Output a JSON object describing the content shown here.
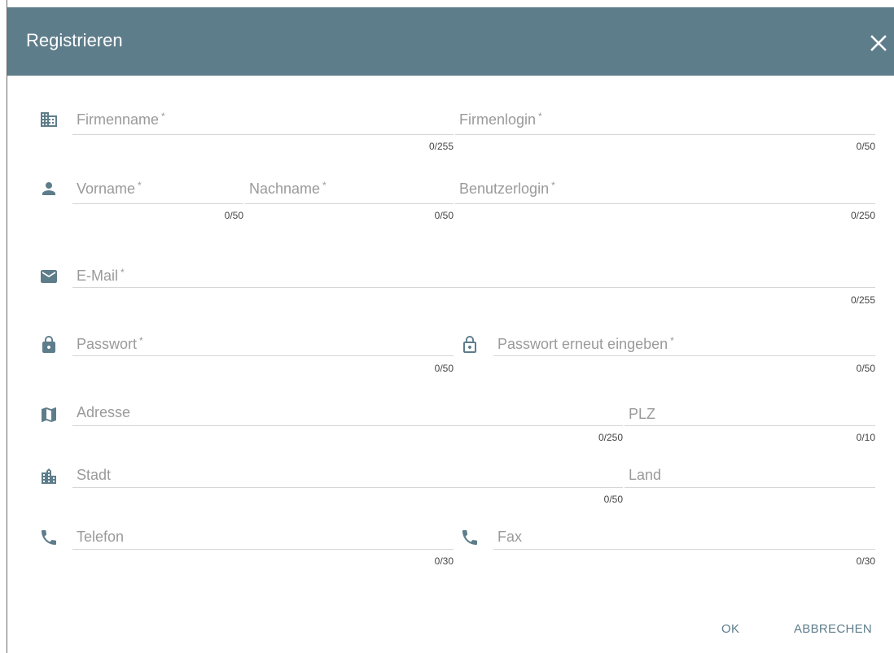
{
  "dialog": {
    "title": "Registrieren"
  },
  "fields": {
    "firmenname": {
      "label": "Firmenname",
      "required": "*",
      "counter": "0/255"
    },
    "firmenlogin": {
      "label": "Firmenlogin",
      "required": "*",
      "counter": "0/50"
    },
    "vorname": {
      "label": "Vorname",
      "required": "*",
      "counter": "0/50"
    },
    "nachname": {
      "label": "Nachname",
      "required": "*",
      "counter": "0/50"
    },
    "benutzerlogin": {
      "label": "Benutzerlogin",
      "required": "*",
      "counter": "0/250"
    },
    "email": {
      "label": "E-Mail",
      "required": "*",
      "counter": "0/255"
    },
    "passwort": {
      "label": "Passwort",
      "required": "*",
      "counter": "0/50"
    },
    "passwort_repeat": {
      "label": "Passwort erneut eingeben",
      "required": "*",
      "counter": "0/50"
    },
    "adresse": {
      "label": "Adresse",
      "counter": "0/250"
    },
    "plz": {
      "label": "PLZ",
      "counter": "0/10"
    },
    "stadt": {
      "label": "Stadt",
      "counter": "0/50"
    },
    "land": {
      "label": "Land"
    },
    "telefon": {
      "label": "Telefon",
      "counter": "0/30"
    },
    "fax": {
      "label": "Fax",
      "counter": "0/30"
    }
  },
  "actions": {
    "ok": "OK",
    "cancel": "ABBRECHEN"
  },
  "colors": {
    "header": "#5e7d8b",
    "icon": "#5e7d8b",
    "label": "#9a9a9a"
  }
}
